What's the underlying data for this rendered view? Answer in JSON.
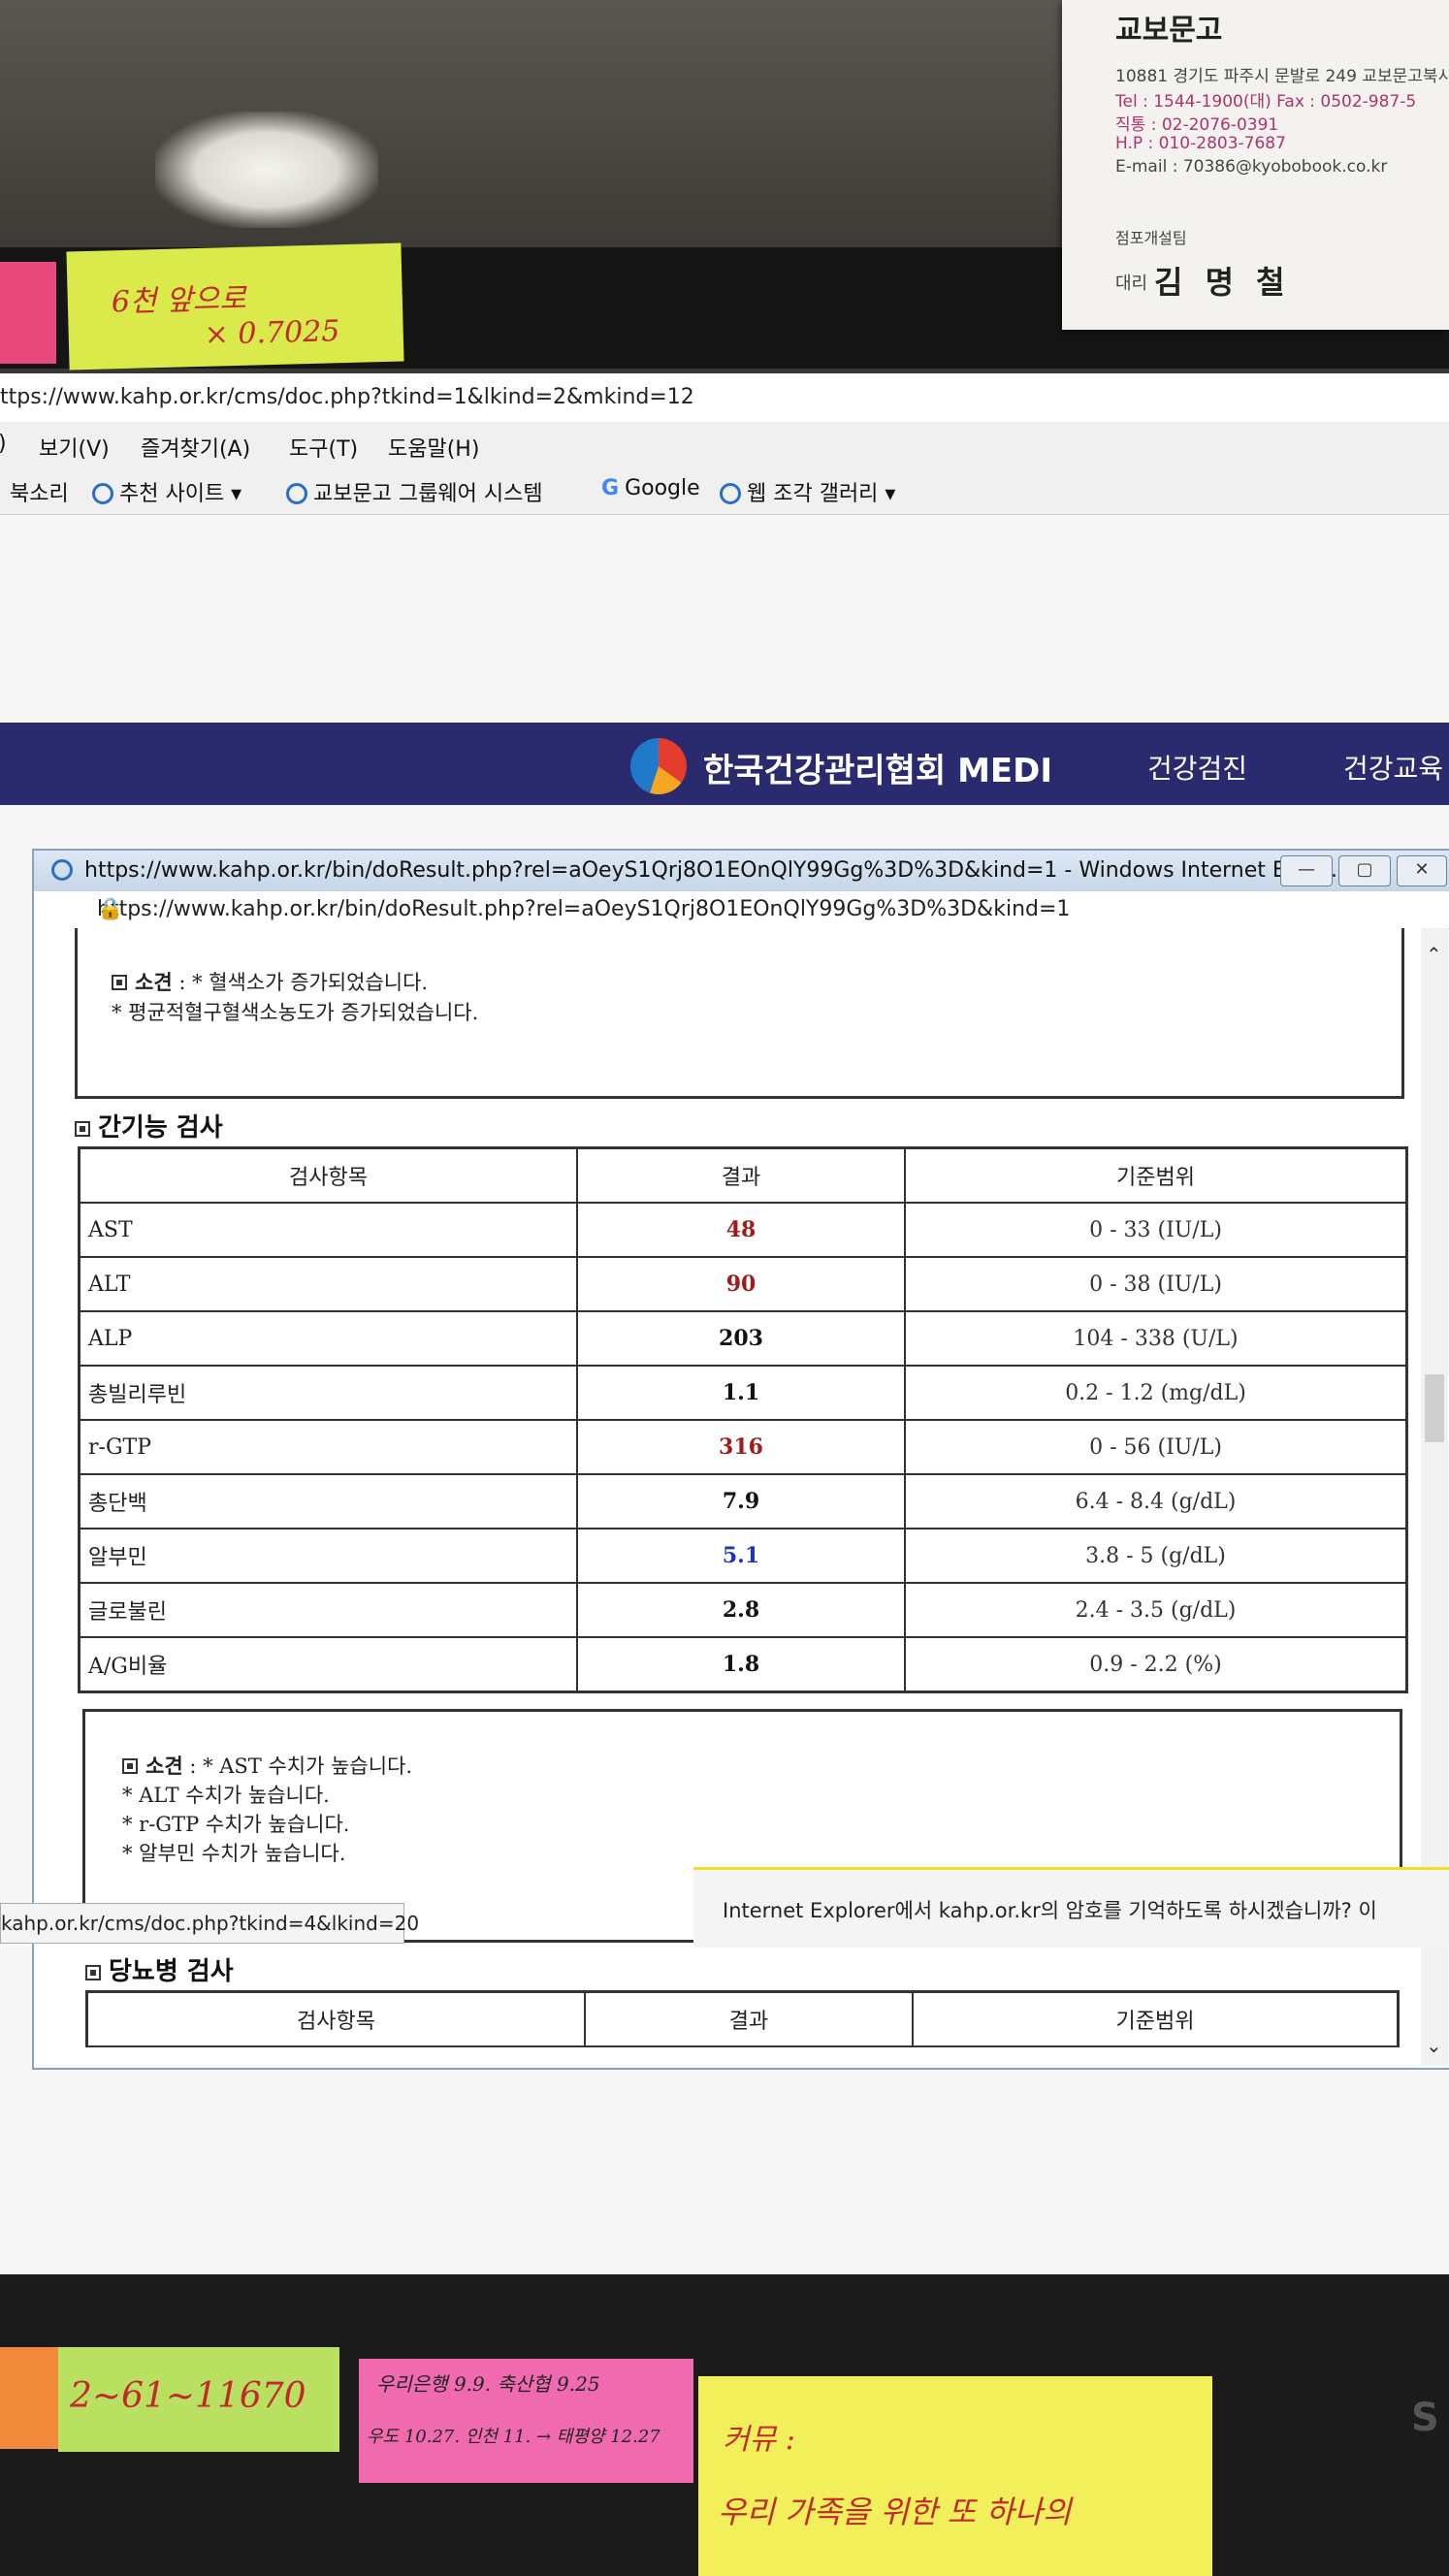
{
  "business_card": {
    "company": "교보문고",
    "address": "10881 경기도 파주시 문발로 249 교보문고북시",
    "tel": "Tel : 1544-1900(대)   Fax : 0502-987-5",
    "direct": "직통 : 02-2076-0391",
    "hp": "H.P : 010-2803-7687",
    "email": "E-mail : 70386@kyobobook.co.kr",
    "team": "점포개설팀",
    "rank": "대리",
    "name": "김 명 철"
  },
  "sticky_notes": {
    "top_green_line1": "6천 앞으로",
    "top_green_line2": "× 0.7025",
    "bottom_green": "2~61~11670",
    "pink_line1": "우리은행 9.9.  축산협 9.25",
    "pink_line2": "우도 10.27.  인천 11. → 태평양 12.27",
    "yellow_line1": "커뮤 :",
    "yellow_line2": "우리 가족을 위한 또 하나의"
  },
  "browser": {
    "url": "ttps://www.kahp.or.kr/cms/doc.php?tkind=1&lkind=2&mkind=12",
    "menu": [
      "보기(V)",
      "즐겨찾기(A)",
      "도구(T)",
      "도움말(H)"
    ],
    "favorites": [
      "북소리",
      "추천 사이트 ▾",
      "교보문고 그룹웨어 시스템",
      "Google",
      "웹 조각 갤러리 ▾"
    ],
    "status_url": "kahp.or.kr/cms/doc.php?tkind=4&lkind=20",
    "password_prompt": "Internet Explorer에서 kahp.or.kr의 암호를 기억하도록 하시겠습니까?    이 ",
    "monitor_brand": "S"
  },
  "site": {
    "name": "한국건강관리협회 MEDI",
    "nav": [
      "건강검진",
      "건강교육"
    ]
  },
  "popup": {
    "title": "https://www.kahp.or.kr/bin/doResult.php?rel=aOeyS1Qrj8O1EOnQlY99Gg%3D%3D&kind=1 - Windows Internet Explo...",
    "address": "https://www.kahp.or.kr/bin/doResult.php?rel=aOeyS1Qrj8O1EOnQlY99Gg%3D%3D&kind=1",
    "window_buttons": [
      "—",
      "▢",
      "✕"
    ]
  },
  "prev_finding": {
    "label": "소견",
    "lines": [
      " : * 혈색소가 증가되었습니다.",
      "* 평균적혈구혈색소농도가 증가되었습니다."
    ]
  },
  "liver": {
    "section_title": "간기능 검사",
    "headers": [
      "검사항목",
      "결과",
      "기준범위"
    ],
    "rows": [
      {
        "name": "AST",
        "result": "48",
        "range": "0 - 33 (IU/L)",
        "flag": "high"
      },
      {
        "name": "ALT",
        "result": "90",
        "range": "0 - 38 (IU/L)",
        "flag": "high"
      },
      {
        "name": "ALP",
        "result": "203",
        "range": "104 - 338 (U/L)",
        "flag": "normal"
      },
      {
        "name": "총빌리루빈",
        "result": "1.1",
        "range": "0.2 - 1.2 (mg/dL)",
        "flag": "normal"
      },
      {
        "name": "r-GTP",
        "result": "316",
        "range": "0 - 56 (IU/L)",
        "flag": "high"
      },
      {
        "name": "총단백",
        "result": "7.9",
        "range": "6.4 - 8.4 (g/dL)",
        "flag": "normal"
      },
      {
        "name": "알부민",
        "result": "5.1",
        "range": "3.8 - 5 (g/dL)",
        "flag": "low"
      },
      {
        "name": "글로불린",
        "result": "2.8",
        "range": "2.4 - 3.5 (g/dL)",
        "flag": "normal"
      },
      {
        "name": "A/G비율",
        "result": "1.8",
        "range": "0.9 - 2.2 (%)",
        "flag": "normal"
      }
    ],
    "finding_label": "소견",
    "finding_lines": [
      " : * AST 수치가 높습니다.",
      "* ALT 수치가 높습니다.",
      "* r-GTP 수치가 높습니다.",
      "* 알부민 수치가 높습니다."
    ]
  },
  "diabetes": {
    "section_title": "당뇨병 검사",
    "headers": [
      "검사항목",
      "결과",
      "기준범위"
    ]
  },
  "colors": {
    "high": "#a01c1c",
    "low": "#1f35b5",
    "site_header": "#2a2a6e"
  }
}
